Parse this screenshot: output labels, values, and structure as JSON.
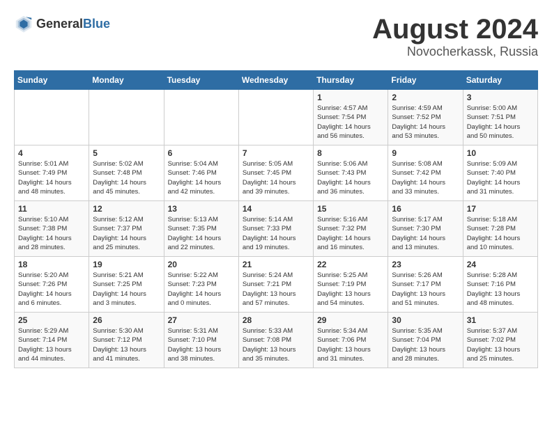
{
  "header": {
    "logo": {
      "general": "General",
      "blue": "Blue"
    },
    "title": "August 2024",
    "subtitle": "Novocherkassk, Russia"
  },
  "weekdays": [
    "Sunday",
    "Monday",
    "Tuesday",
    "Wednesday",
    "Thursday",
    "Friday",
    "Saturday"
  ],
  "weeks": [
    [
      {
        "day": "",
        "info": ""
      },
      {
        "day": "",
        "info": ""
      },
      {
        "day": "",
        "info": ""
      },
      {
        "day": "",
        "info": ""
      },
      {
        "day": "1",
        "info": "Sunrise: 4:57 AM\nSunset: 7:54 PM\nDaylight: 14 hours\nand 56 minutes."
      },
      {
        "day": "2",
        "info": "Sunrise: 4:59 AM\nSunset: 7:52 PM\nDaylight: 14 hours\nand 53 minutes."
      },
      {
        "day": "3",
        "info": "Sunrise: 5:00 AM\nSunset: 7:51 PM\nDaylight: 14 hours\nand 50 minutes."
      }
    ],
    [
      {
        "day": "4",
        "info": "Sunrise: 5:01 AM\nSunset: 7:49 PM\nDaylight: 14 hours\nand 48 minutes."
      },
      {
        "day": "5",
        "info": "Sunrise: 5:02 AM\nSunset: 7:48 PM\nDaylight: 14 hours\nand 45 minutes."
      },
      {
        "day": "6",
        "info": "Sunrise: 5:04 AM\nSunset: 7:46 PM\nDaylight: 14 hours\nand 42 minutes."
      },
      {
        "day": "7",
        "info": "Sunrise: 5:05 AM\nSunset: 7:45 PM\nDaylight: 14 hours\nand 39 minutes."
      },
      {
        "day": "8",
        "info": "Sunrise: 5:06 AM\nSunset: 7:43 PM\nDaylight: 14 hours\nand 36 minutes."
      },
      {
        "day": "9",
        "info": "Sunrise: 5:08 AM\nSunset: 7:42 PM\nDaylight: 14 hours\nand 33 minutes."
      },
      {
        "day": "10",
        "info": "Sunrise: 5:09 AM\nSunset: 7:40 PM\nDaylight: 14 hours\nand 31 minutes."
      }
    ],
    [
      {
        "day": "11",
        "info": "Sunrise: 5:10 AM\nSunset: 7:38 PM\nDaylight: 14 hours\nand 28 minutes."
      },
      {
        "day": "12",
        "info": "Sunrise: 5:12 AM\nSunset: 7:37 PM\nDaylight: 14 hours\nand 25 minutes."
      },
      {
        "day": "13",
        "info": "Sunrise: 5:13 AM\nSunset: 7:35 PM\nDaylight: 14 hours\nand 22 minutes."
      },
      {
        "day": "14",
        "info": "Sunrise: 5:14 AM\nSunset: 7:33 PM\nDaylight: 14 hours\nand 19 minutes."
      },
      {
        "day": "15",
        "info": "Sunrise: 5:16 AM\nSunset: 7:32 PM\nDaylight: 14 hours\nand 16 minutes."
      },
      {
        "day": "16",
        "info": "Sunrise: 5:17 AM\nSunset: 7:30 PM\nDaylight: 14 hours\nand 13 minutes."
      },
      {
        "day": "17",
        "info": "Sunrise: 5:18 AM\nSunset: 7:28 PM\nDaylight: 14 hours\nand 10 minutes."
      }
    ],
    [
      {
        "day": "18",
        "info": "Sunrise: 5:20 AM\nSunset: 7:26 PM\nDaylight: 14 hours\nand 6 minutes."
      },
      {
        "day": "19",
        "info": "Sunrise: 5:21 AM\nSunset: 7:25 PM\nDaylight: 14 hours\nand 3 minutes."
      },
      {
        "day": "20",
        "info": "Sunrise: 5:22 AM\nSunset: 7:23 PM\nDaylight: 14 hours\nand 0 minutes."
      },
      {
        "day": "21",
        "info": "Sunrise: 5:24 AM\nSunset: 7:21 PM\nDaylight: 13 hours\nand 57 minutes."
      },
      {
        "day": "22",
        "info": "Sunrise: 5:25 AM\nSunset: 7:19 PM\nDaylight: 13 hours\nand 54 minutes."
      },
      {
        "day": "23",
        "info": "Sunrise: 5:26 AM\nSunset: 7:17 PM\nDaylight: 13 hours\nand 51 minutes."
      },
      {
        "day": "24",
        "info": "Sunrise: 5:28 AM\nSunset: 7:16 PM\nDaylight: 13 hours\nand 48 minutes."
      }
    ],
    [
      {
        "day": "25",
        "info": "Sunrise: 5:29 AM\nSunset: 7:14 PM\nDaylight: 13 hours\nand 44 minutes."
      },
      {
        "day": "26",
        "info": "Sunrise: 5:30 AM\nSunset: 7:12 PM\nDaylight: 13 hours\nand 41 minutes."
      },
      {
        "day": "27",
        "info": "Sunrise: 5:31 AM\nSunset: 7:10 PM\nDaylight: 13 hours\nand 38 minutes."
      },
      {
        "day": "28",
        "info": "Sunrise: 5:33 AM\nSunset: 7:08 PM\nDaylight: 13 hours\nand 35 minutes."
      },
      {
        "day": "29",
        "info": "Sunrise: 5:34 AM\nSunset: 7:06 PM\nDaylight: 13 hours\nand 31 minutes."
      },
      {
        "day": "30",
        "info": "Sunrise: 5:35 AM\nSunset: 7:04 PM\nDaylight: 13 hours\nand 28 minutes."
      },
      {
        "day": "31",
        "info": "Sunrise: 5:37 AM\nSunset: 7:02 PM\nDaylight: 13 hours\nand 25 minutes."
      }
    ]
  ]
}
